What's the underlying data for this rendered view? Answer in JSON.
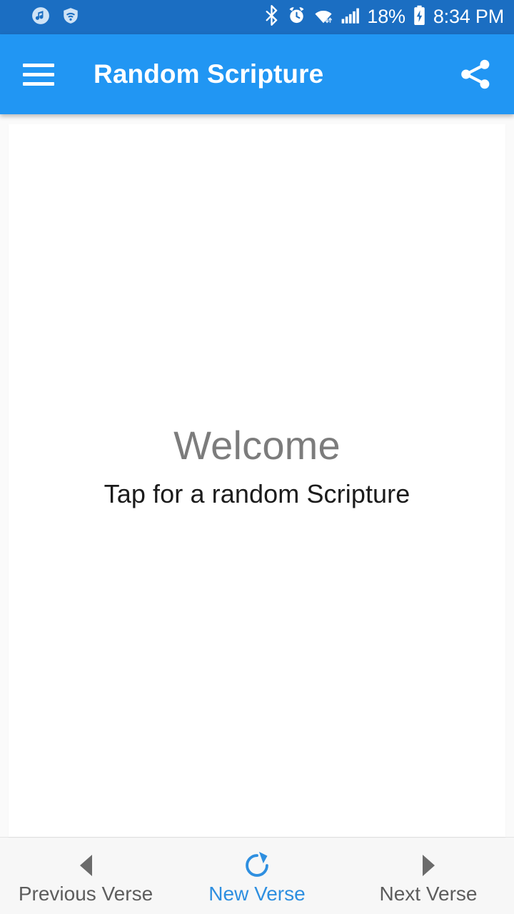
{
  "status_bar": {
    "left_icons": [
      "music-note-icon",
      "wifi-shield-icon"
    ],
    "right_icons": [
      "bluetooth-icon",
      "alarm-clock-icon",
      "wifi-icon",
      "cellular-signal-icon"
    ],
    "battery_percent": "18%",
    "battery_icon": "battery-charging-icon",
    "time": "8:34 PM",
    "background_color": "#1b6ec2"
  },
  "app_bar": {
    "menu_icon": "hamburger-menu-icon",
    "title": "Random Scripture",
    "share_icon": "share-icon",
    "background_color": "#2196f3",
    "text_color": "#ffffff"
  },
  "content": {
    "heading": "Welcome",
    "subheading": "Tap for a random Scripture",
    "heading_color": "#7c7c7c",
    "subheading_color": "#1b1b1b",
    "card_background": "#ffffff"
  },
  "bottom_bar": {
    "background_color": "#f7f7f7",
    "accent_color": "#2e8fe0",
    "items": [
      {
        "label": "Previous Verse",
        "icon": "triangle-left-icon"
      },
      {
        "label": "New Verse",
        "icon": "refresh-icon"
      },
      {
        "label": "Next Verse",
        "icon": "triangle-right-icon"
      }
    ]
  }
}
